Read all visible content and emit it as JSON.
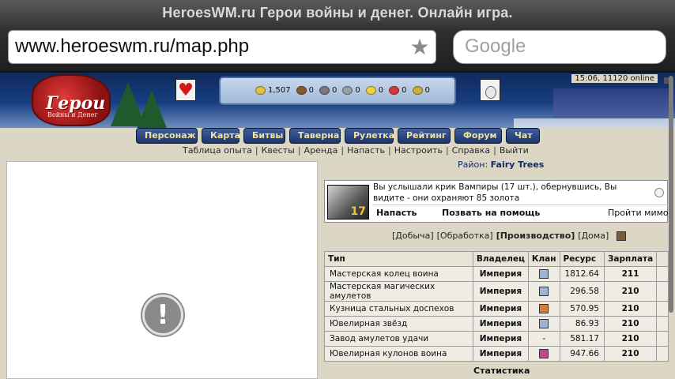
{
  "browser": {
    "title": "HeroesWM.ru Герои войны и денег. Онлайн игра.",
    "url": "www.heroeswm.ru/map.php",
    "search_placeholder": "Google"
  },
  "header": {
    "logo_text": "Герои",
    "logo_sub": "Войны и Денег",
    "time_online": "15:06, 11120 online",
    "resources": [
      {
        "name": "gold",
        "value": "1,507",
        "color": "#e8c23a"
      },
      {
        "name": "wood",
        "value": "0",
        "color": "#8a5a2b"
      },
      {
        "name": "ore",
        "value": "0",
        "color": "#7a7a7a"
      },
      {
        "name": "mercury",
        "value": "0",
        "color": "#9aa0a6"
      },
      {
        "name": "sulfur",
        "value": "0",
        "color": "#f2d23c"
      },
      {
        "name": "crystals",
        "value": "0",
        "color": "#d43a3a"
      },
      {
        "name": "gems",
        "value": "0",
        "color": "#c8b13a"
      }
    ]
  },
  "nav": {
    "items": [
      "Персонаж",
      "Карта",
      "Битвы",
      "Таверна",
      "Рулетка",
      "Рейтинг",
      "Форум",
      "Чат"
    ]
  },
  "links": [
    "Таблица опыта",
    "Квесты",
    "Аренда",
    "Напасть",
    "Настроить",
    "Справка",
    "Выйти"
  ],
  "region": {
    "label": "Район:",
    "name": "Fairy Trees"
  },
  "event": {
    "text": "Вы услышали крик Вампиры (17 шт.), обернувшись, Вы видите - они охраняют 85 золота",
    "level": "17",
    "attack": "Напасть",
    "help": "Позвать на помощь",
    "pass": "Пройти мимо"
  },
  "tabs": {
    "items": [
      "[Добыча]",
      "[Обработка]",
      "[Производство]",
      "[Дома]"
    ],
    "active_index": 2
  },
  "table": {
    "headers": [
      "Тип",
      "Владелец",
      "Клан",
      "Ресурс",
      "Зарплата"
    ],
    "rows": [
      {
        "type": "Мастерская колец воина",
        "owner": "Империя",
        "clan": "icon",
        "resource": "1812.64",
        "pay": "211"
      },
      {
        "type": "Мастерская магических амулетов",
        "owner": "Империя",
        "clan": "icon",
        "resource": "296.58",
        "pay": "210"
      },
      {
        "type": "Кузница стальных доспехов",
        "owner": "Империя",
        "clan": "icon",
        "resource": "570.95",
        "pay": "210"
      },
      {
        "type": "Ювелирная звёзд",
        "owner": "Империя",
        "clan": "icon",
        "resource": "86.93",
        "pay": "210"
      },
      {
        "type": "Завод амулетов удачи",
        "owner": "Империя",
        "clan": "-",
        "resource": "581.17",
        "pay": "210"
      },
      {
        "type": "Ювелирная кулонов воина",
        "owner": "Империя",
        "clan": "icon",
        "resource": "947.66",
        "pay": "210"
      }
    ],
    "clan_colors": [
      "#9fb3d6",
      "#9fb3d6",
      "#d67a3a",
      "#9fb3d6",
      "",
      "#c04a8a"
    ]
  },
  "stats_label": "Статистика",
  "icons": {
    "bookmark": "star-icon",
    "heart": "heart-icon",
    "bottle": "bottle-icon",
    "error": "error-icon",
    "home": "home-icon"
  },
  "colors": {
    "page_bg": "#dcd7c5",
    "nav_text": "#f4e29c",
    "nav_bg": "#1d356b",
    "region_text": "#0f2a5c"
  }
}
